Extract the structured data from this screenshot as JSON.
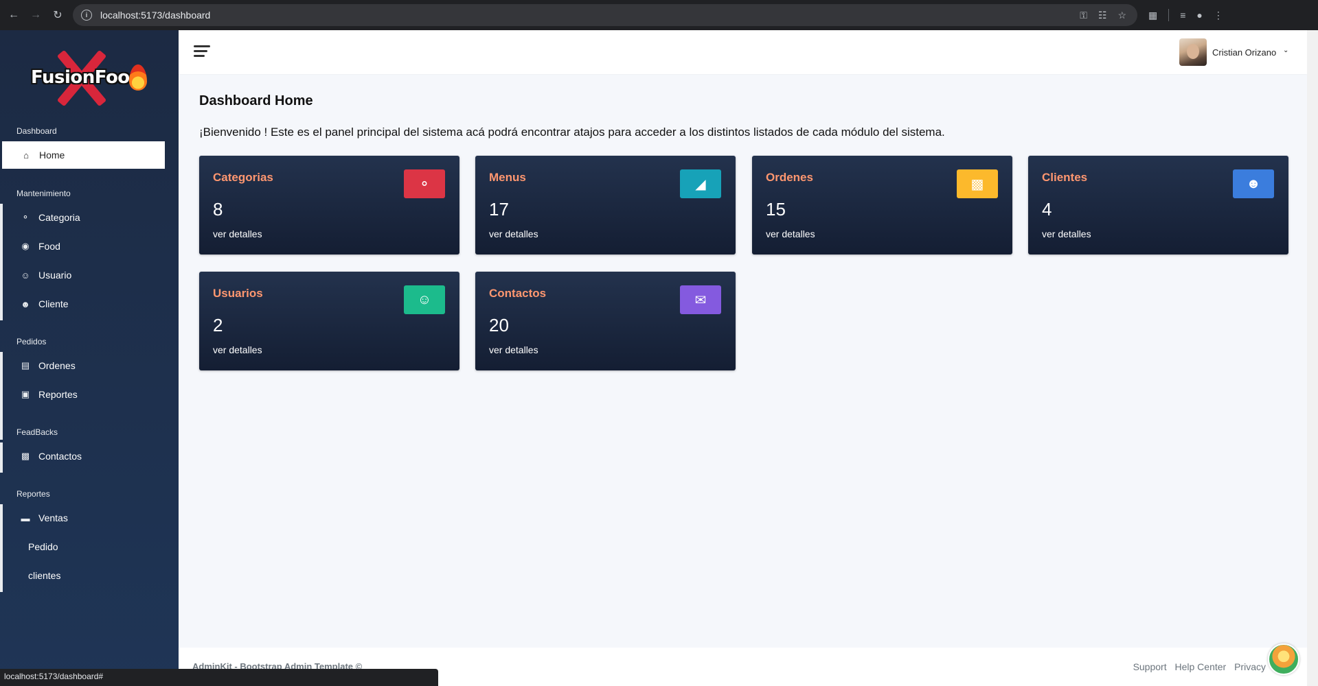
{
  "browser": {
    "url": "localhost:5173/dashboard"
  },
  "sidebar": {
    "brand": "FusionFood",
    "sections": [
      {
        "title": "Dashboard"
      },
      {
        "title": "Mantenimiento"
      },
      {
        "title": "Pedidos"
      },
      {
        "title": "FeadBacks"
      },
      {
        "title": "Reportes"
      }
    ],
    "items": {
      "home": {
        "label": "Home",
        "icon": "home-icon"
      },
      "categoria": {
        "label": "Categoria",
        "icon": "tag-icon"
      },
      "food": {
        "label": "Food",
        "icon": "food-icon"
      },
      "usuario": {
        "label": "Usuario",
        "icon": "user-icon"
      },
      "cliente": {
        "label": "Cliente",
        "icon": "users-icon"
      },
      "ordenes": {
        "label": "Ordenes",
        "icon": "clipboard-icon"
      },
      "reportes": {
        "label": "Reportes",
        "icon": "pdf-icon"
      },
      "contactos": {
        "label": "Contactos",
        "icon": "contact-book-icon"
      },
      "ventas": {
        "label": "Ventas",
        "icon": "card-icon"
      },
      "pedido": {
        "label": "Pedido"
      },
      "clientes": {
        "label": "clientes"
      }
    }
  },
  "topbar": {
    "user_name": "Cristian Orizano"
  },
  "main": {
    "title_bold": "Dashboard",
    "title_rest": "Home",
    "welcome": "¡Bienvenido ! Este es el panel principal del sistema acá podrá encontrar atajos para acceder a los distintos listados de cada módulo del sistema.",
    "cards": [
      {
        "title": "Categorias",
        "count": "8",
        "link": "ver detalles",
        "icon": "tags-icon",
        "color": "#dc3545"
      },
      {
        "title": "Menus",
        "count": "17",
        "link": "ver detalles",
        "icon": "pizza-icon",
        "color": "#17a2b8"
      },
      {
        "title": "Ordenes",
        "count": "15",
        "link": "ver detalles",
        "icon": "boxes-icon",
        "color": "#fcb92c"
      },
      {
        "title": "Clientes",
        "count": "4",
        "link": "ver detalles",
        "icon": "users-icon",
        "color": "#3b7ddd"
      },
      {
        "title": "Usuarios",
        "count": "2",
        "link": "ver detalles",
        "icon": "user-tie-icon",
        "color": "#1cbb8c"
      },
      {
        "title": "Contactos",
        "count": "20",
        "link": "ver detalles",
        "icon": "envelope-icon",
        "color": "#845adf"
      }
    ]
  },
  "footer": {
    "text": "AdminKit - Bootstrap Admin Template ©",
    "links": [
      "Support",
      "Help Center",
      "Privacy"
    ]
  },
  "status_bar": {
    "text": "localhost:5173/dashboard#"
  }
}
